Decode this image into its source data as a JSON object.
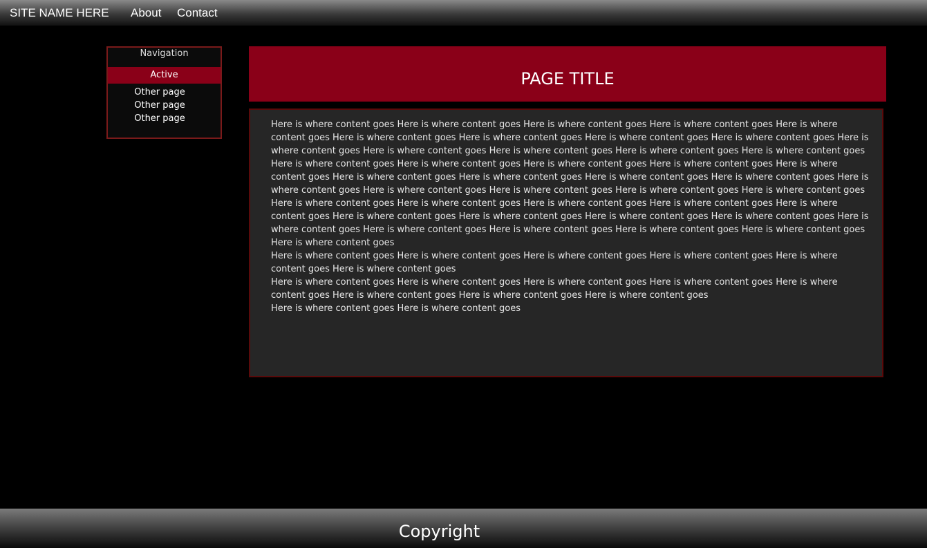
{
  "header": {
    "site_name": "SITE NAME HERE",
    "nav": [
      "About",
      "Contact"
    ]
  },
  "sidebar": {
    "title": "Navigation",
    "active": "Active",
    "items": [
      "Other page",
      "Other page",
      "Other page"
    ]
  },
  "main": {
    "title": "PAGE TITLE",
    "paragraphs": [
      "Here is where content goes Here is where content goes Here is where content goes Here is where content goes Here is where content goes Here is where content goes Here is where content goes Here is where content goes Here is where content goes Here is where content goes Here is where content goes Here is where content goes Here is where content goes Here is where content goes Here is where content goes Here is where content goes Here is where content goes Here is where content goes Here is where content goes Here is where content goes Here is where content goes Here is where content goes Here is where content goes Here is where content goes Here is where content goes Here is where content goes Here is where content goes Here is where content goes Here is where content goes Here is where content goes Here is where content goes Here is where content goes Here is where content goes Here is where content goes Here is where content goes Here is where content goes Here is where content goes Here is where content goes Here is where content goes Here is where content goes Here is where content goes Here is where content goes Here is where content goes",
      "Here is where content goes Here is where content goes Here is where content goes Here is where content goes Here is where content goes Here is where content goes",
      "Here is where content goes Here is where content goes Here is where content goes Here is where content goes Here is where content goes Here is where content goes Here is where content goes Here is where content goes",
      "Here is where content goes Here is where content goes"
    ]
  },
  "footer": {
    "copyright": "Copyright"
  }
}
